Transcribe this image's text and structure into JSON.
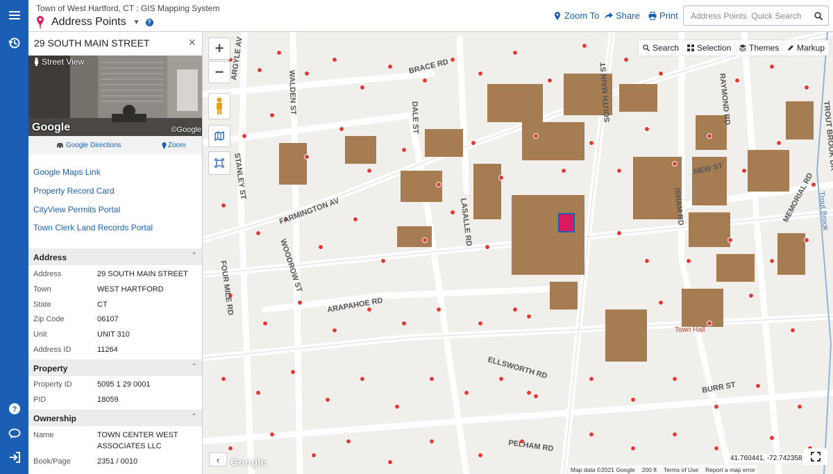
{
  "header": {
    "app_title": "Town of West Hartford, CT : GIS Mapping System",
    "layer_name": "Address Points",
    "help": "?",
    "zoom_to": "Zoom To",
    "share": "Share",
    "print": "Print",
    "search_placeholder": "Address Points  Quick Search"
  },
  "panel": {
    "title": "29 SOUTH MAIN STREET",
    "close": "×",
    "street_view_label": "Street View",
    "street_view_watermark": "Google",
    "street_view_watermark_small": "©Google",
    "google_directions": "Google Directions",
    "zoom": "Zoom",
    "links": [
      "Google Maps Link",
      "Property Record Card",
      "CityView Permits Portal",
      "Town Clerk Land Records Portal"
    ],
    "sections": [
      {
        "title": "Address",
        "rows": [
          {
            "label": "Address",
            "value": "29 SOUTH MAIN STREET"
          },
          {
            "label": "Town",
            "value": "WEST HARTFORD"
          },
          {
            "label": "State",
            "value": "CT"
          },
          {
            "label": "Zip Code",
            "value": "06107"
          },
          {
            "label": "Unit",
            "value": "UNIT 310"
          },
          {
            "label": "Address ID",
            "value": "11264"
          }
        ]
      },
      {
        "title": "Property",
        "rows": [
          {
            "label": "Property ID",
            "value": "5095 1 29 0001"
          },
          {
            "label": "PID",
            "value": "18059"
          }
        ]
      },
      {
        "title": "Ownership",
        "rows": [
          {
            "label": "Name",
            "value": "TOWN CENTER WEST ASSOCIATES LLC"
          },
          {
            "label": "Book/Page",
            "value": "2351 / 0010"
          }
        ]
      }
    ]
  },
  "map": {
    "toolbar": [
      "Search",
      "Selection",
      "Themes",
      "Markup"
    ],
    "coords": "41.760441, -72.742358",
    "attribution": [
      "Map data ©2021 Google",
      "200 ft",
      "Terms of Use",
      "Report a map error"
    ],
    "google_logo": "Google",
    "streets": [
      "ARGYLE AV",
      "WALDEN ST",
      "BRACE RD",
      "DALE ST",
      "FARMINGTON AV",
      "STANLEY ST",
      "LASALLE RD",
      "SOUTH MAIN ST",
      "ISHAM RD",
      "NEW ST",
      "RAYMOND RD",
      "MEMORIAL RD",
      "TROUT BROOK DR",
      "Trout Brook",
      "FOUR MILE RD",
      "WOODROW ST",
      "ARAPAHOE RD",
      "ELLSWORTH RD",
      "BURR ST",
      "PELHAM RD",
      "Town Hall"
    ],
    "colors": {
      "building": "#a67c52",
      "point": "#e53935",
      "road": "#ffffff",
      "selected": "#d81b60"
    }
  }
}
